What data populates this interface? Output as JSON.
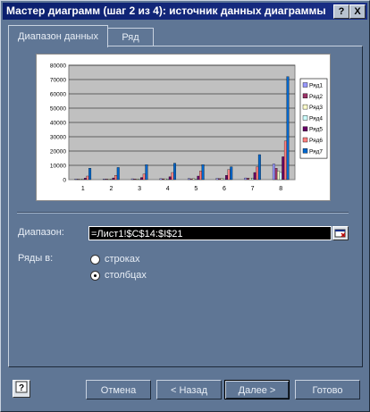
{
  "window": {
    "title": "Мастер диаграмм (шаг 2 из 4): источник данных диаграммы",
    "help_btn": "?",
    "close_btn": "X"
  },
  "tabs": [
    {
      "label": "Диапазон данных",
      "active": true
    },
    {
      "label": "Ряд",
      "active": false
    }
  ],
  "range": {
    "label": "Диапазон:",
    "value": "=Лист1!$C$14:$I$21"
  },
  "rows_in": {
    "label": "Ряды в:",
    "options": [
      {
        "label": "строках",
        "selected": false
      },
      {
        "label": "столбцах",
        "selected": true
      }
    ]
  },
  "buttons": {
    "cancel": "Отмена",
    "back": "< Назад",
    "next": "Далее >",
    "finish": "Готово"
  },
  "colors": {
    "dialog_bg": "#5f7695",
    "plot_bg": "#c0c0c0",
    "title_bar": "#0b1f6e"
  },
  "chart_data": {
    "type": "bar",
    "categories": [
      "1",
      "2",
      "3",
      "4",
      "5",
      "6",
      "7",
      "8"
    ],
    "ylim": [
      0,
      80000
    ],
    "yticks": [
      "0",
      "10000",
      "20000",
      "30000",
      "40000",
      "50000",
      "60000",
      "70000",
      "80000"
    ],
    "grid": true,
    "legend": "right",
    "series": [
      {
        "name": "Ряд1",
        "color": "#9999ff",
        "values": [
          500,
          500,
          600,
          700,
          800,
          900,
          1200,
          11000
        ]
      },
      {
        "name": "Ряд2",
        "color": "#993366",
        "values": [
          300,
          400,
          500,
          600,
          600,
          700,
          1000,
          8000
        ]
      },
      {
        "name": "Ряд3",
        "color": "#ffffcc",
        "values": [
          400,
          400,
          500,
          600,
          700,
          800,
          1100,
          6000
        ]
      },
      {
        "name": "Ряд4",
        "color": "#ccffff",
        "values": [
          300,
          300,
          400,
          500,
          500,
          600,
          900,
          5000
        ]
      },
      {
        "name": "Ряд5",
        "color": "#660066",
        "values": [
          1000,
          1200,
          1500,
          2000,
          2500,
          3000,
          5000,
          16000
        ]
      },
      {
        "name": "Ряд6",
        "color": "#ff8080",
        "values": [
          2500,
          3000,
          4000,
          5000,
          6000,
          7000,
          9000,
          27000
        ]
      },
      {
        "name": "Ряд7",
        "color": "#0066cc",
        "values": [
          8000,
          8500,
          10500,
          11500,
          10500,
          9000,
          17500,
          72000
        ]
      }
    ]
  }
}
